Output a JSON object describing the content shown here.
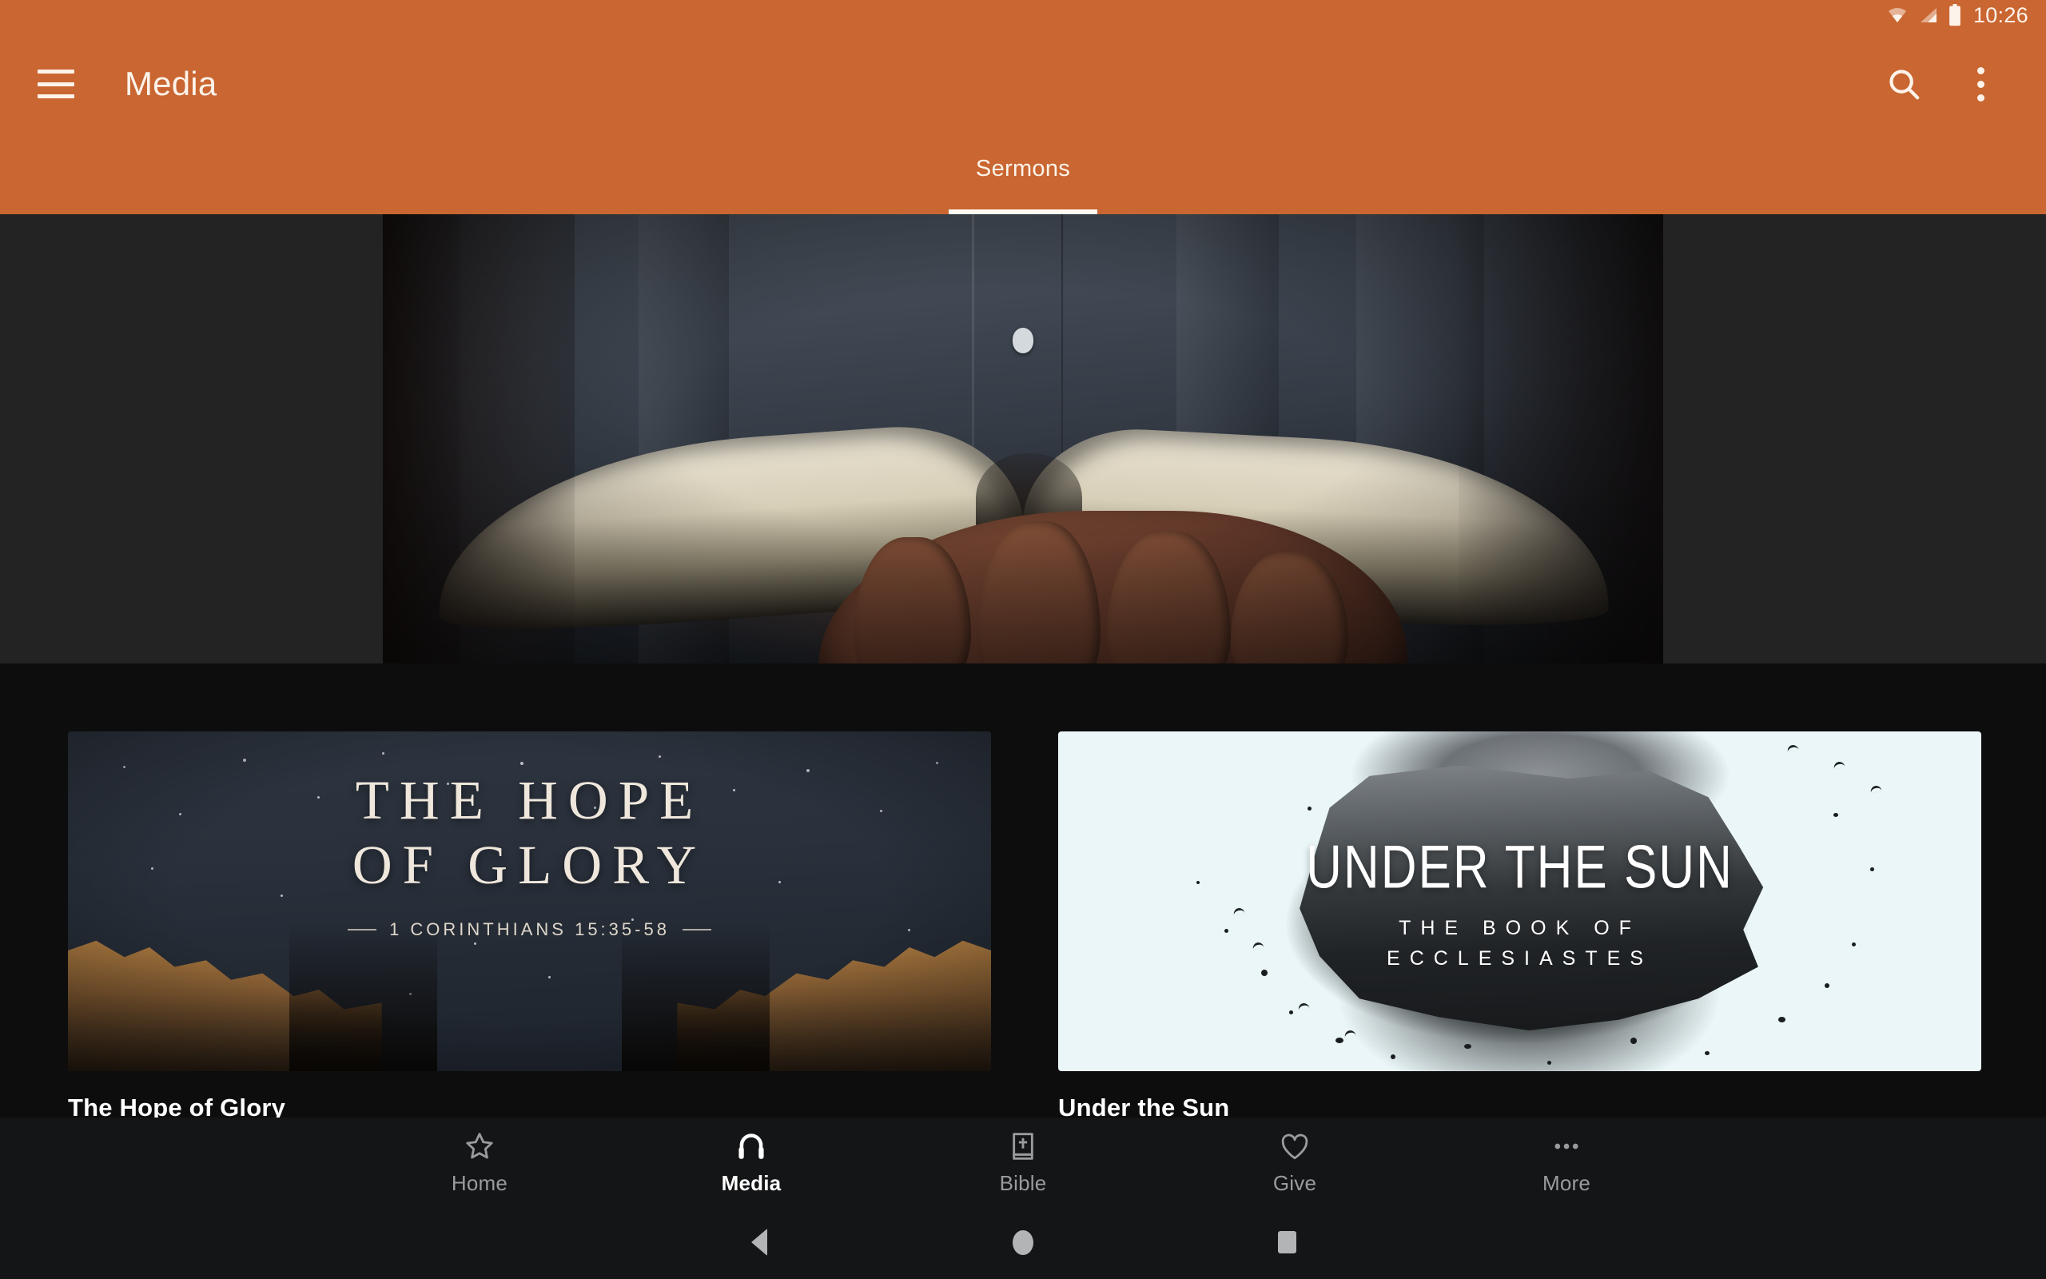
{
  "status_bar": {
    "time": "10:26",
    "icons": [
      "wifi-icon",
      "cellular-signal-icon",
      "battery-icon"
    ]
  },
  "app_bar": {
    "menu_icon": "hamburger-menu-icon",
    "title": "Media",
    "actions": [
      {
        "icon": "search-icon",
        "label": "Search"
      },
      {
        "icon": "overflow-menu-icon",
        "label": "More options"
      }
    ],
    "accent_color": "#c96631",
    "on_accent_color": "#fdf3ea"
  },
  "tabs": {
    "items": [
      {
        "label": "Sermons",
        "selected": true
      }
    ],
    "indicator_color": "#fffaf4"
  },
  "hero": {
    "name": "sermon-hero-image",
    "description": "Hands holding an open Bible against a denim shirt",
    "letterbox_color": "#232323"
  },
  "sermon_series": [
    {
      "title": "The Hope of Glory",
      "art": {
        "headline_line_1": "THE HOPE",
        "headline_line_2": "OF GLORY",
        "reference": "1 CORINTHIANS 15:35-58",
        "background_color": "#2a313c",
        "text_color": "#efe7dc"
      }
    },
    {
      "title": "Under the Sun",
      "art": {
        "headline": "UNDER THE SUN",
        "subtitle_line_1": "THE BOOK OF",
        "subtitle_line_2": "ECCLESIASTES",
        "background_color": "#eaf6f8",
        "text_color": "#ffffff"
      }
    }
  ],
  "bottom_nav": {
    "items": [
      {
        "label": "Home",
        "icon": "star-outline-icon",
        "active": false
      },
      {
        "label": "Media",
        "icon": "headphones-icon",
        "active": true
      },
      {
        "label": "Bible",
        "icon": "book-cross-icon",
        "active": false
      },
      {
        "label": "Give",
        "icon": "heart-outline-icon",
        "active": false
      },
      {
        "label": "More",
        "icon": "ellipsis-icon",
        "active": false
      }
    ],
    "active_color": "#ffffff",
    "inactive_color": "#9a9b9d"
  },
  "system_nav": {
    "items": [
      {
        "icon": "back-triangle-icon",
        "label": "Back"
      },
      {
        "icon": "home-circle-icon",
        "label": "Home"
      },
      {
        "icon": "recents-square-icon",
        "label": "Recents"
      }
    ]
  }
}
